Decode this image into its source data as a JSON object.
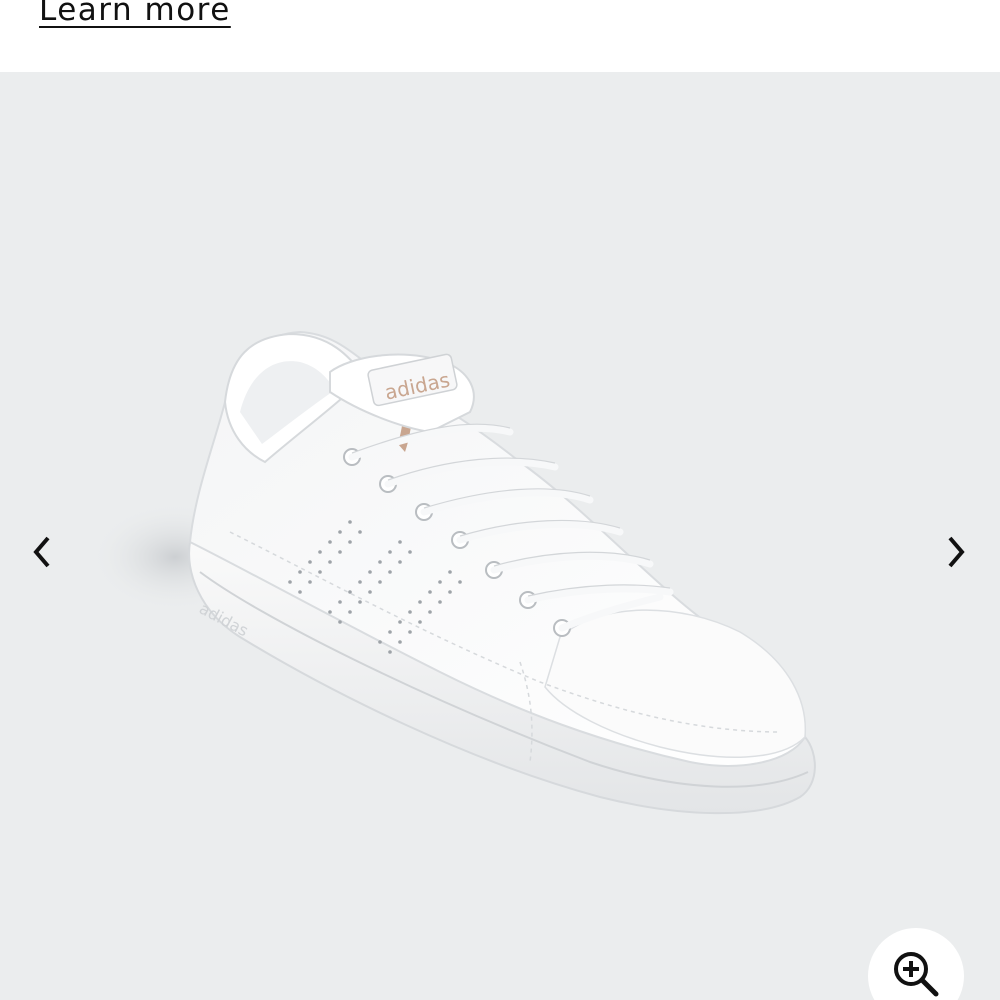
{
  "header": {
    "learn_more_label": "Learn more"
  },
  "gallery": {
    "image_alt": "White adidas leather sneaker with rose-gold heel tab",
    "brand_text_on_shoe": "adidas",
    "prev_icon": "chevron-left-icon",
    "next_icon": "chevron-right-icon",
    "zoom_icon": "zoom-in-icon"
  },
  "colors": {
    "background": "#ffffff",
    "gallery_background": "#ebedee",
    "text": "#111111",
    "accent_rose_gold": "#c9a690"
  }
}
